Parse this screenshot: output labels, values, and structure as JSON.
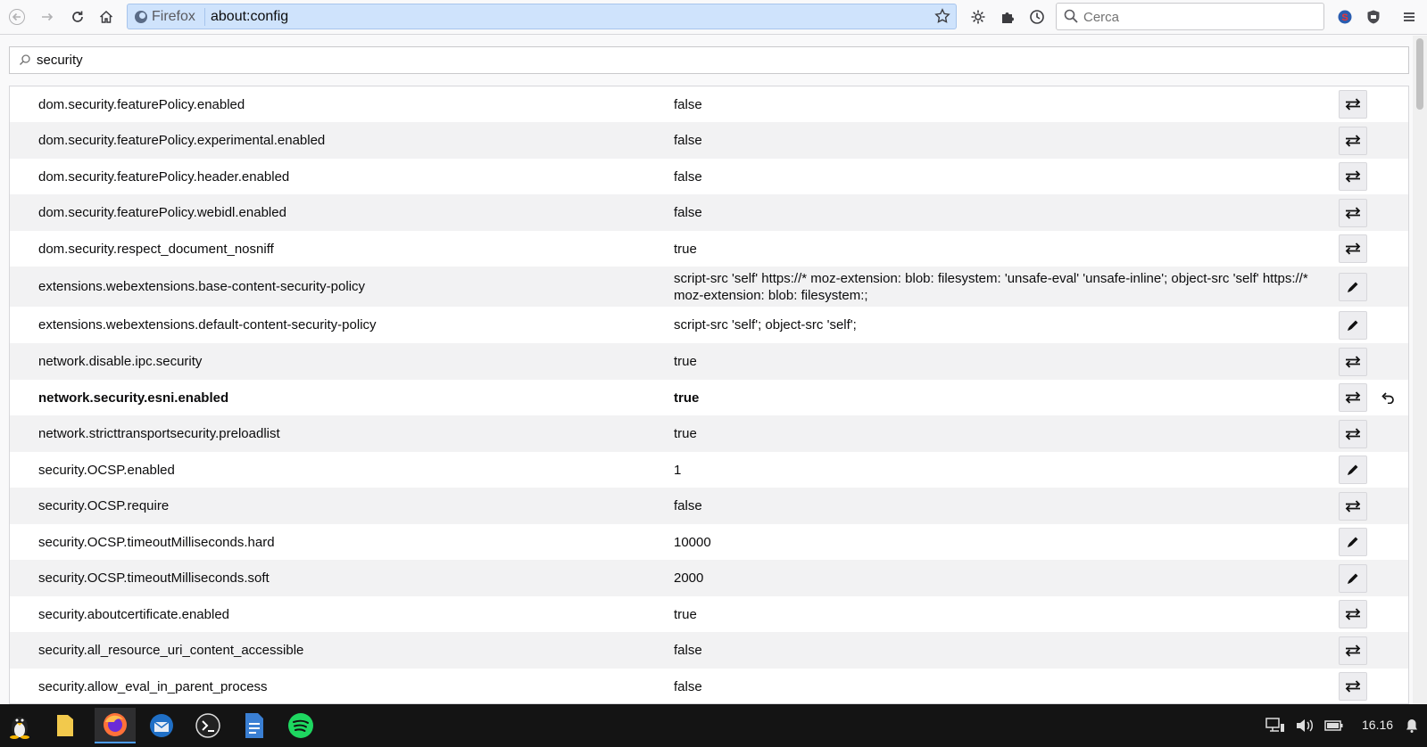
{
  "browser": {
    "identity_label": "Firefox",
    "url": "about:config",
    "search_placeholder": "Cerca"
  },
  "filter": {
    "value": "security"
  },
  "prefs": [
    {
      "name": "dom.security.featurePolicy.enabled",
      "value": "false",
      "action": "toggle"
    },
    {
      "name": "dom.security.featurePolicy.experimental.enabled",
      "value": "false",
      "action": "toggle"
    },
    {
      "name": "dom.security.featurePolicy.header.enabled",
      "value": "false",
      "action": "toggle"
    },
    {
      "name": "dom.security.featurePolicy.webidl.enabled",
      "value": "false",
      "action": "toggle"
    },
    {
      "name": "dom.security.respect_document_nosniff",
      "value": "true",
      "action": "toggle"
    },
    {
      "name": "extensions.webextensions.base-content-security-policy",
      "value": "script-src 'self' https://* moz-extension: blob: filesystem: 'unsafe-eval' 'unsafe-inline'; object-src 'self' https://* moz-extension: blob: filesystem:;",
      "action": "edit"
    },
    {
      "name": "extensions.webextensions.default-content-security-policy",
      "value": "script-src 'self'; object-src 'self';",
      "action": "edit"
    },
    {
      "name": "network.disable.ipc.security",
      "value": "true",
      "action": "toggle"
    },
    {
      "name": "network.security.esni.enabled",
      "value": "true",
      "action": "toggle",
      "modified": true
    },
    {
      "name": "network.stricttransportsecurity.preloadlist",
      "value": "true",
      "action": "toggle"
    },
    {
      "name": "security.OCSP.enabled",
      "value": "1",
      "action": "edit"
    },
    {
      "name": "security.OCSP.require",
      "value": "false",
      "action": "toggle"
    },
    {
      "name": "security.OCSP.timeoutMilliseconds.hard",
      "value": "10000",
      "action": "edit"
    },
    {
      "name": "security.OCSP.timeoutMilliseconds.soft",
      "value": "2000",
      "action": "edit"
    },
    {
      "name": "security.aboutcertificate.enabled",
      "value": "true",
      "action": "toggle"
    },
    {
      "name": "security.all_resource_uri_content_accessible",
      "value": "false",
      "action": "toggle"
    },
    {
      "name": "security.allow_eval_in_parent_process",
      "value": "false",
      "action": "toggle"
    }
  ],
  "taskbar": {
    "clock": "16.16"
  }
}
